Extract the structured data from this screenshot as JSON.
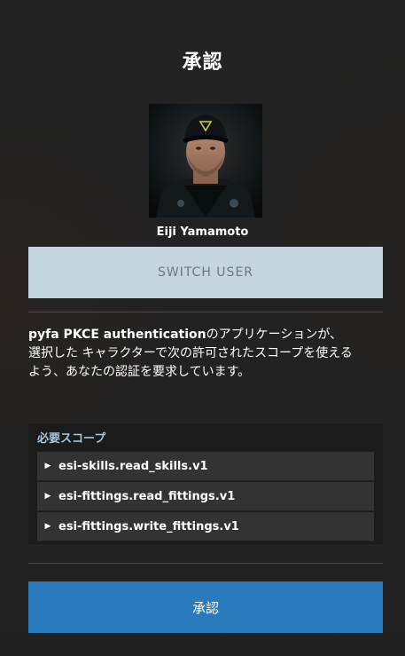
{
  "header": {
    "title": "承認"
  },
  "character": {
    "name": "Eiji Yamamoto"
  },
  "switch_user": {
    "label": "SWITCH USER"
  },
  "description": {
    "app_name": "pyfa PKCE authentication",
    "text": "のアプリケーションが、 選択した キャラクターで次の許可されたスコープを使えるよう、あなたの認証を要求しています。"
  },
  "scopes": {
    "heading": "必要スコープ",
    "items": [
      {
        "label": "esi-skills.read_skills.v1"
      },
      {
        "label": "esi-fittings.read_fittings.v1"
      },
      {
        "label": "esi-fittings.write_fittings.v1"
      }
    ]
  },
  "approve": {
    "label": "承認"
  },
  "colors": {
    "switch_bg": "#c4d5df",
    "approve_bg": "#2a7bbd",
    "scope_heading": "#a9c6d8"
  }
}
